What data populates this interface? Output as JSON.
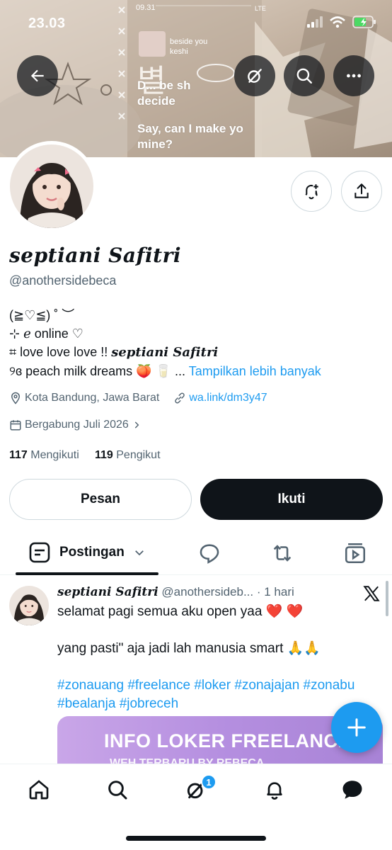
{
  "status_bar": {
    "time": "23.03",
    "icons": [
      "signal-icon",
      "wifi-icon",
      "battery-charging-icon"
    ]
  },
  "banner": {
    "phone_time": "09.31",
    "phone_signal": "LTE",
    "song_title": "beside you",
    "song_artist": "keshi",
    "hangul": "별",
    "line1": "D... be sh",
    "line2": "decide",
    "line3": "Say, can I make yo",
    "line4": "mine?"
  },
  "header_buttons": {
    "back": "back-arrow-icon",
    "grok": "slash-circle-icon",
    "search": "search-icon",
    "more": "more-icon"
  },
  "profile": {
    "display_name": "𝒔𝒆𝒑𝒕𝒊𝒂𝒏𝒊 𝑺𝒂𝒇𝒊𝒕𝒓𝒊",
    "handle": "@anothersidebeca",
    "bio_line1": "(≧♡≦) ˚ ︶",
    "bio_line2": "⊹ ℯ online ♡",
    "bio_line3_prefix": "⌗ love love love !! ",
    "bio_line3_name": "𝒔𝒆𝒑𝒕𝒊𝒂𝒏𝒊 𝑺𝒂𝒇𝒊𝒕𝒓𝒊",
    "bio_line4": "୨ɞ peach milk dreams 🍑 🥛  ...",
    "show_more": "Tampilkan lebih banyak",
    "location": "Kota Bandung, Jawa Barat",
    "link": "wa.link/dm3y47",
    "joined": "Bergabung Juli 2026",
    "following_count": "117",
    "following_label": "Mengikuti",
    "followers_count": "119",
    "followers_label": "Pengikut"
  },
  "actions": {
    "message": "Pesan",
    "follow": "Ikuti"
  },
  "tabs": {
    "posts": "Postingan"
  },
  "post": {
    "name": "𝒔𝒆𝒑𝒕𝒊𝒂𝒏𝒊 𝑺𝒂𝒇𝒊𝒕𝒓𝒊",
    "handle": "@anothersideb...",
    "time": "· 1 hari",
    "line1": "selamat pagi semua aku open yaa ❤️ ❤️",
    "line2": "yang pasti\" aja jadi lah manusia smart 🙏🙏",
    "hashtags1": "#zonauang #freelance #loker #zonajajan #zonabu",
    "hashtags2": "#bealanja #jobreceh",
    "image_text": "INFO LOKER FREELANCE",
    "image_sub": "WEH TERBARU BY REBECA"
  },
  "bottom_nav": {
    "notification_badge": "1"
  },
  "colors": {
    "accent": "#1d9bf0",
    "text": "#0f1419",
    "secondary": "#536471",
    "border": "#cfd9de"
  }
}
